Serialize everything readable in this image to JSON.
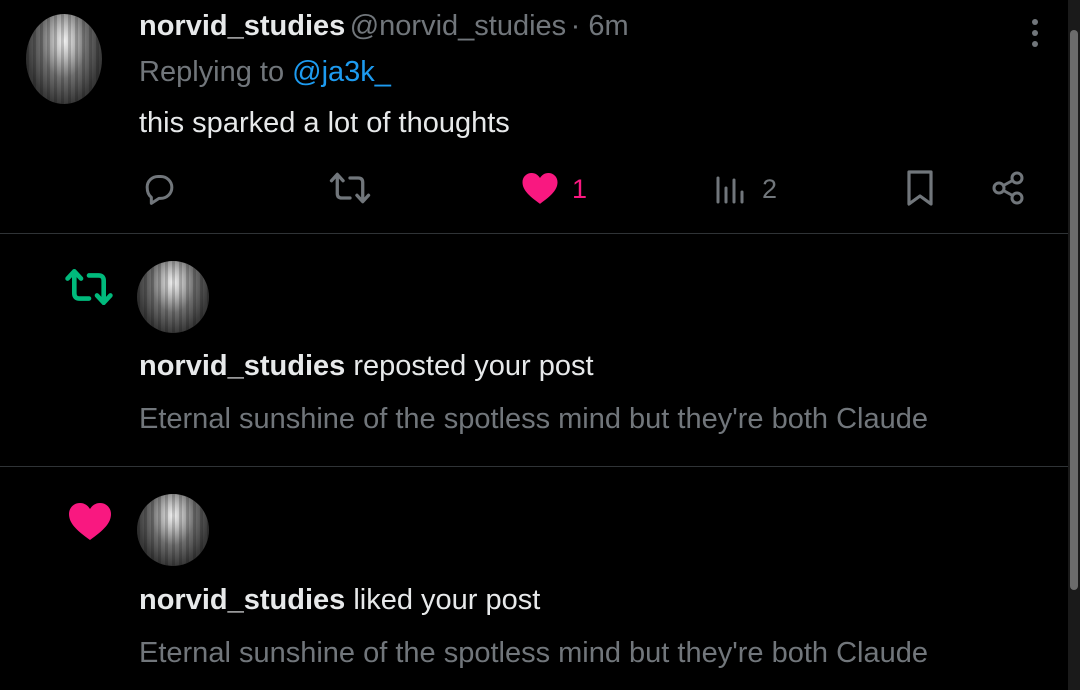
{
  "reply": {
    "display_name": "norvid_studies",
    "handle": "@norvid_studies",
    "time": "· 6m",
    "replying_prefix": "Replying to",
    "replying_to": "@ja3k_",
    "text": "this sparked a lot of thoughts",
    "like_count": "1",
    "view_count": "2"
  },
  "notifications": [
    {
      "type": "repost",
      "actor": "norvid_studies",
      "action": "reposted your post",
      "snippet": "Eternal sunshine of the spotless mind but they're both Claude"
    },
    {
      "type": "like",
      "actor": "norvid_studies",
      "action": "liked your post",
      "snippet": "Eternal sunshine of the spotless mind but they're both Claude"
    }
  ],
  "colors": {
    "background": "#000000",
    "text_primary": "#e7e9ea",
    "text_secondary": "#71767b",
    "link": "#1d9bf0",
    "like": "#f91880",
    "repost": "#00ba7c"
  },
  "icons": [
    "more-icon",
    "reply-icon",
    "repost-icon",
    "heart-icon",
    "views-icon",
    "bookmark-icon",
    "share-icon"
  ]
}
